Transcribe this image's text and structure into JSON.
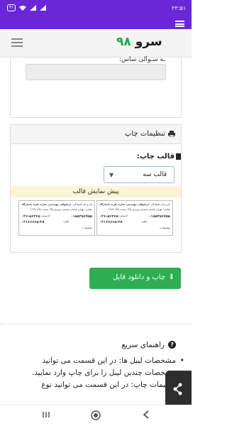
{
  "status_bar": {
    "time": "۲۳:۵۱",
    "battery": "۳۱",
    "accent": "#6a27d8"
  },
  "site": {
    "logo_text": "سرو",
    "logo_num": "۹۸"
  },
  "previous_card": {
    "partial_label": "ـه سـوالی ساس:"
  },
  "print_settings": {
    "title": "تنظیمات چاپ",
    "template_label": "قالب چاپ:",
    "template_selected": "قالب سه",
    "preview_label": "پیش نمایش قالب"
  },
  "labels": [
    {
      "sender": "نام و نام خانوادگی: فرستنده",
      "company": "شرکت مهندسی تجارت فرید پاسارگاد",
      "address": "نشانی: تهران خیابان سعیدی پرویزی پلاک بیست پلاک ۲۱۷۳",
      "postal_label": "کدپستی:",
      "postal_code": "۰۱۵۸۳۵۶۷۵۵",
      "phone_label": "تلفن:",
      "phone": "۰۲۶-۵۶۳۶۵",
      "mobile_label": "تلفن:",
      "mobile": "۰۲۱۶۶۶۶۵-۲۸",
      "desc": "توضیحات:"
    },
    {
      "sender": "نام و نام خانوادگی: فرستنده",
      "company": "شرکت مهندسی تجارت فرید پاسارگاد",
      "address": "نشانی: تهران خیابان سعیدی پرویزی پلاک بیست پلاک ۲۱۷۳",
      "postal_label": "کدپستی:",
      "postal_code": "۰۱۵۸۳۵۶۷۵۵",
      "phone_label": "تلفن:",
      "phone": "۰۲۶-۵۶۳۶۵",
      "mobile_label": "تلفن:",
      "mobile": "۰۲۱۶۶۶۶۵-۲۸",
      "desc": "توضیحات:"
    }
  ],
  "download_button": {
    "label": "چاپ و دانلود فایل",
    "color": "#2fae51"
  },
  "guide": {
    "title": "راهنمای سریع",
    "items": [
      "مشخصات لیبل ها: در این قسمت می توانید مشخصات چندین لیبل را برای چاپ وارد نمایید.",
      "تنظیمات چاپ: در این قسمت می توانید نوع"
    ]
  }
}
